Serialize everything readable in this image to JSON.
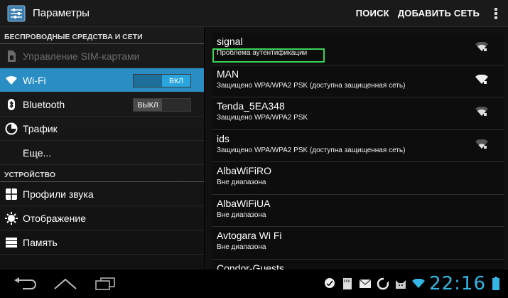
{
  "header": {
    "title": "Параметры",
    "search_label": "ПОИСК",
    "add_network_label": "ДОБАВИТЬ СЕТЬ"
  },
  "sidebar": {
    "section_wireless": "БЕСПРОВОДНЫЕ СРЕДСТВА И СЕТИ",
    "section_device": "УСТРОЙСТВО",
    "items": [
      {
        "label": "Управление SIM-картами",
        "icon": "sim-card-icon",
        "disabled": true
      },
      {
        "label": "Wi-Fi",
        "icon": "wifi-icon",
        "selected": true,
        "toggle": "ВКЛ"
      },
      {
        "label": "Bluetooth",
        "icon": "bluetooth-icon",
        "toggle": "ВЫКЛ"
      },
      {
        "label": "Трафик",
        "icon": "data-usage-icon"
      },
      {
        "label": "Еще..."
      },
      {
        "label": "Профили звука",
        "icon": "sound-icon"
      },
      {
        "label": "Отображение",
        "icon": "display-icon"
      },
      {
        "label": "Память",
        "icon": "storage-icon"
      }
    ]
  },
  "networks": [
    {
      "ssid": "signal",
      "status": "Проблема аутентификации",
      "signal_icon": "wifi-signal-icon"
    },
    {
      "ssid": "MAN",
      "status": "Защищено WPA/WPA2 PSK (доступна защищенная сеть)",
      "signal_icon": "wifi-signal-icon"
    },
    {
      "ssid": "Tenda_5EA348",
      "status": "Защищено WPA/WPA2 PSK",
      "signal_icon": "wifi-signal-icon"
    },
    {
      "ssid": "ids",
      "status": "Защищено WPA/WPA2 PSK (доступна защищенная сеть)",
      "signal_icon": "wifi-signal-icon"
    },
    {
      "ssid": "AlbaWiFiRO",
      "status": "Вне диапазона"
    },
    {
      "ssid": "AlbaWiFiUA",
      "status": "Вне диапазона"
    },
    {
      "ssid": "Avtogara Wi Fi",
      "status": "Вне диапазона"
    },
    {
      "ssid": "Condor-Guests",
      "status": ""
    }
  ],
  "statusbar": {
    "time": "22:16"
  },
  "colors": {
    "accent": "#33b5e5",
    "selected": "#2a8ec4",
    "highlight_border": "#3dd05a"
  }
}
